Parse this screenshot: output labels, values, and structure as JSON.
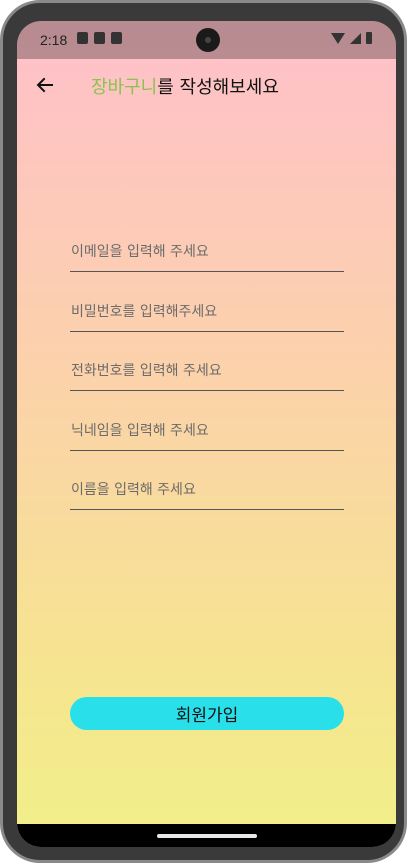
{
  "status_bar": {
    "time": "2:18",
    "icons_left": [
      "shield-icon",
      "sd-card-icon",
      "image-icon"
    ],
    "icons_right": [
      "wifi-icon",
      "signal-icon",
      "battery-icon"
    ]
  },
  "app_bar": {
    "back_icon": "arrow-left-icon",
    "title_accent": "장바구니",
    "title_rest": "를 작성해보세요",
    "accent_color": "#8bc34a"
  },
  "form": {
    "email_placeholder": "이메일을 입력해 주세요",
    "password_placeholder": "비밀번호를 입력해주세요",
    "phone_placeholder": "전화번호를 입력해 주세요",
    "nickname_placeholder": "닉네임을 입력해 주세요",
    "name_placeholder": "이름을 입력해 주세요"
  },
  "signup_button": {
    "label": "회원가입",
    "color": "#29e0ea"
  },
  "colors": {
    "background_top": "#ffc0cb",
    "background_bottom": "#f1f08a"
  }
}
